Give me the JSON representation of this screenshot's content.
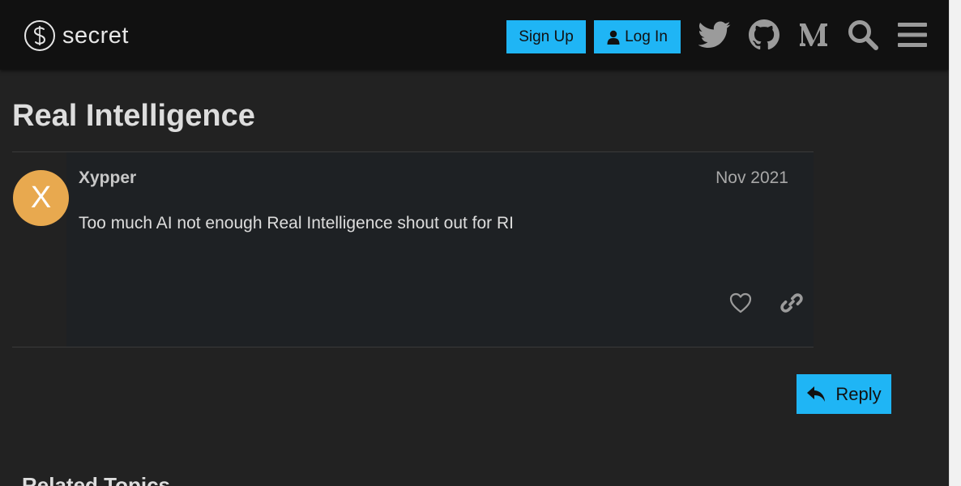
{
  "header": {
    "logo_text": "secret",
    "signup_label": "Sign Up",
    "login_label": "Log In",
    "icons": [
      "twitter-icon",
      "github-icon",
      "medium-icon",
      "search-icon",
      "hamburger-menu-icon"
    ]
  },
  "topic": {
    "title": "Real Intelligence"
  },
  "post": {
    "avatar_letter": "X",
    "username": "Xypper",
    "date": "Nov 2021",
    "text": "Too much AI not enough Real Intelligence shout out for RI"
  },
  "reply_label": "Reply",
  "related_heading": "Related Topics",
  "colors": {
    "background": "#222222",
    "header": "#111111",
    "accent": "#1fb5f5",
    "avatar": "#e8a94f",
    "post_bg": "#1e2124"
  }
}
